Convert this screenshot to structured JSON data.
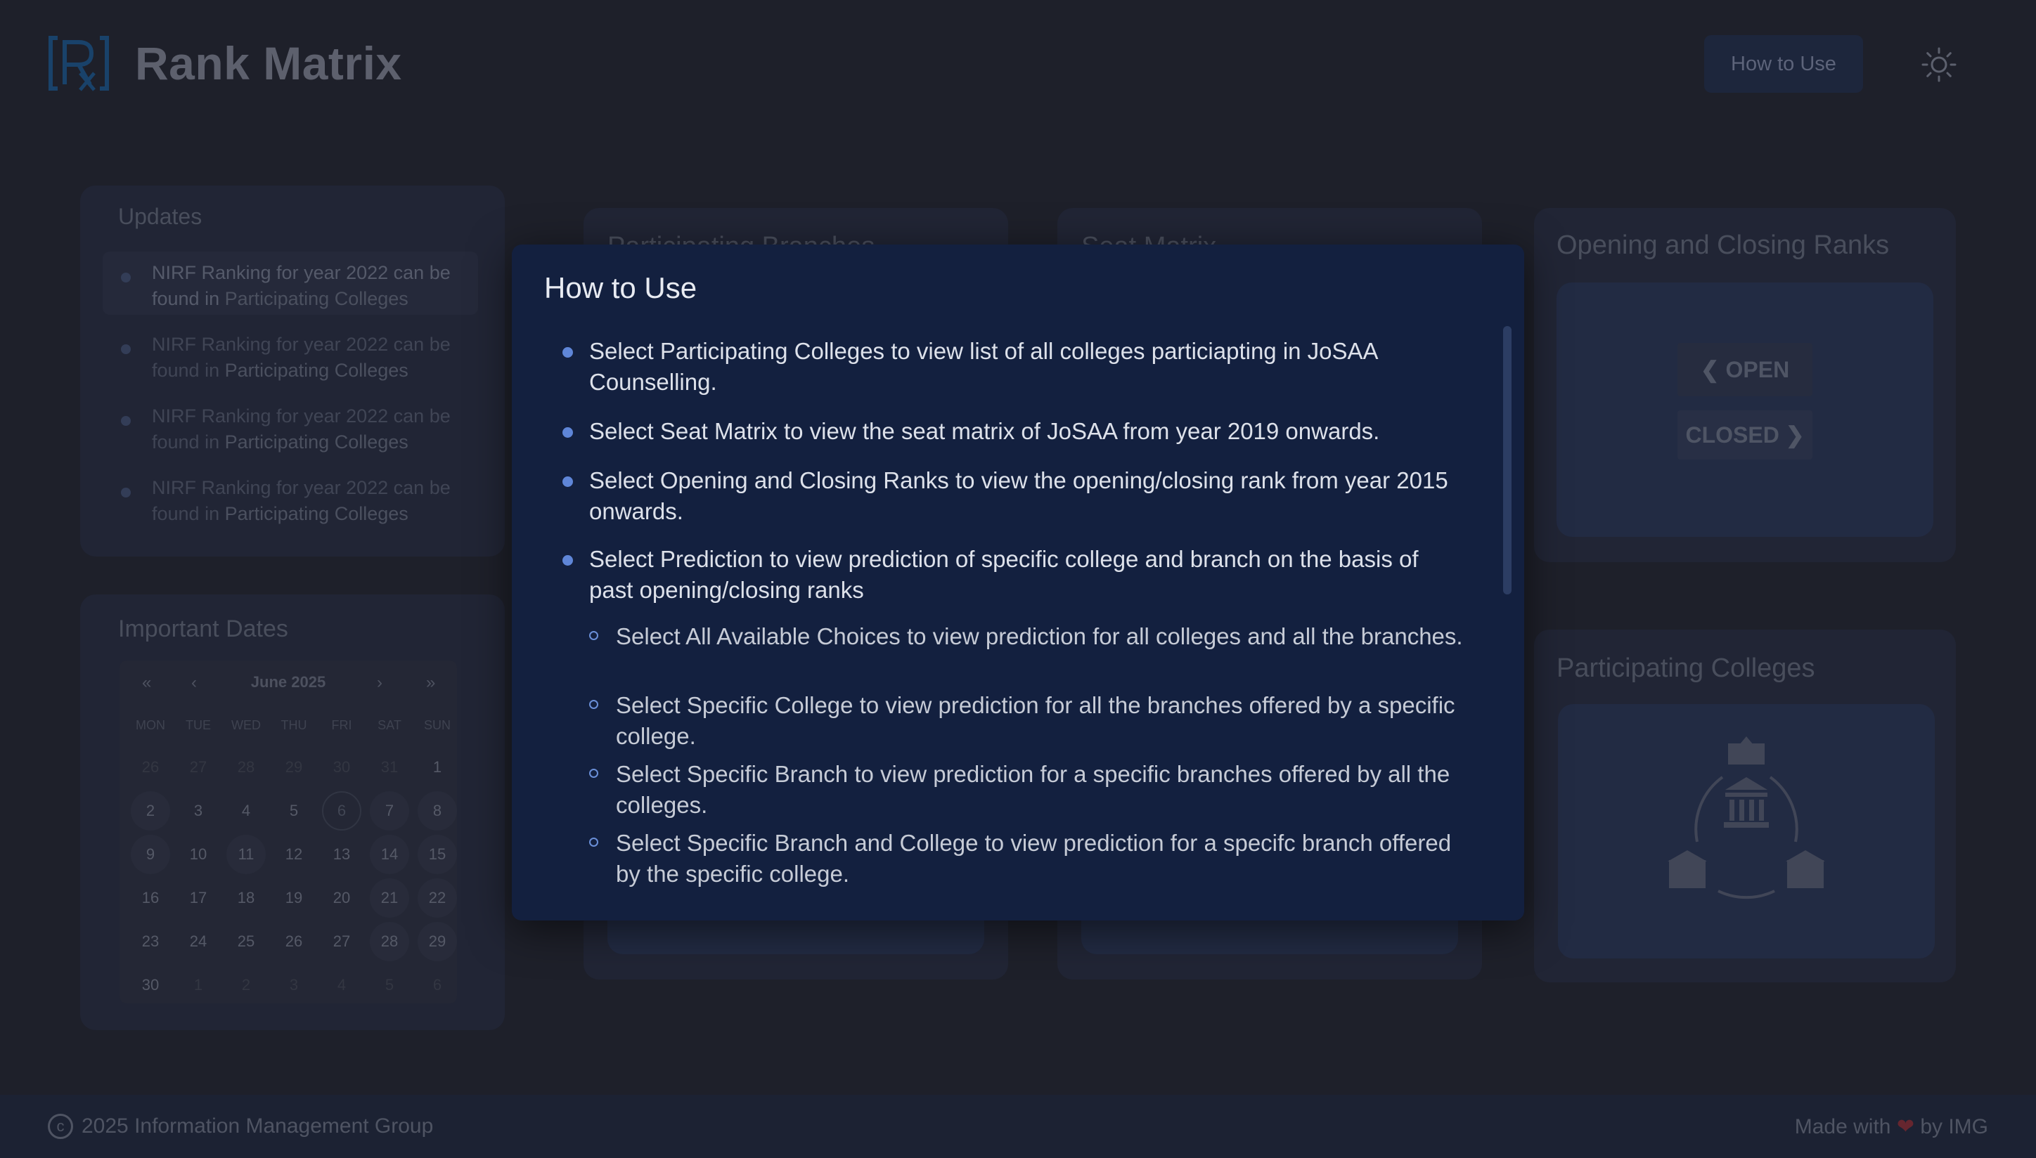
{
  "header": {
    "brand": "Rank Matrix",
    "howto_label": "How to Use",
    "theme_icon": "sun-icon"
  },
  "updates": {
    "title": "Updates",
    "items": [
      {
        "text": "NIRF Ranking for year 2022 can be found in",
        "link": "Participating Colleges"
      },
      {
        "text": "NIRF Ranking for year 2022 can be found in",
        "link": "Participating Colleges"
      },
      {
        "text": "NIRF Ranking for year 2022 can be found in",
        "link": "Participating Colleges"
      },
      {
        "text": "NIRF Ranking for year 2022 can be found in",
        "link": "Participating Colleges"
      }
    ]
  },
  "dates": {
    "title": "Important Dates",
    "nav": {
      "first": "«",
      "prev": "‹",
      "next": "›",
      "last": "»"
    },
    "month": "June 2025",
    "weekdays": [
      "MON",
      "TUE",
      "WED",
      "THU",
      "FRI",
      "SAT",
      "SUN"
    ],
    "weeks": [
      [
        "26",
        "27",
        "28",
        "29",
        "30",
        "31",
        "1"
      ],
      [
        "2",
        "3",
        "4",
        "5",
        "6",
        "7",
        "8"
      ],
      [
        "9",
        "10",
        "11",
        "12",
        "13",
        "14",
        "15"
      ],
      [
        "16",
        "17",
        "18",
        "19",
        "20",
        "21",
        "22"
      ],
      [
        "23",
        "24",
        "25",
        "26",
        "27",
        "28",
        "29"
      ],
      [
        "30",
        "1",
        "2",
        "3",
        "4",
        "5",
        "6"
      ]
    ]
  },
  "cards": {
    "branches": "Participating Branches",
    "seat": "Seat Matrix",
    "ranks": "Opening and Closing Ranks",
    "open": "OPEN",
    "closed": "CLOSED",
    "colleges": "Participating Colleges"
  },
  "modal": {
    "title": "How to Use",
    "bullets": [
      "Select Participating Colleges to view list of all colleges particiapting in JoSAA Counselling.",
      "Select Seat Matrix to view the seat matrix of JoSAA from year 2019 onwards.",
      "Select Opening and Closing Ranks to view the opening/closing rank from year 2015 onwards.",
      "Select Prediction to view prediction of specific college and branch on the basis of past opening/closing ranks"
    ],
    "sub_bullets": [
      "Select All Available Choices to view prediction for all colleges and all the branches.",
      "Select Specific College to view prediction for all the branches offered by a specific college.",
      "Select Specific Branch to view prediction for a specific branches offered by all the colleges.",
      "Select Specific Branch and College to view prediction for a specifc branch offered by the specific college."
    ]
  },
  "footer": {
    "copyright": "2025 Information Management Group",
    "made_prefix": "Made with",
    "made_suffix": "by IMG"
  },
  "colors": {
    "page_bg": "#23252f",
    "modal_bg": "#13203f",
    "accent": "#5f86d8",
    "logo": "#1f5a8a",
    "heart": "#7a2c35"
  }
}
